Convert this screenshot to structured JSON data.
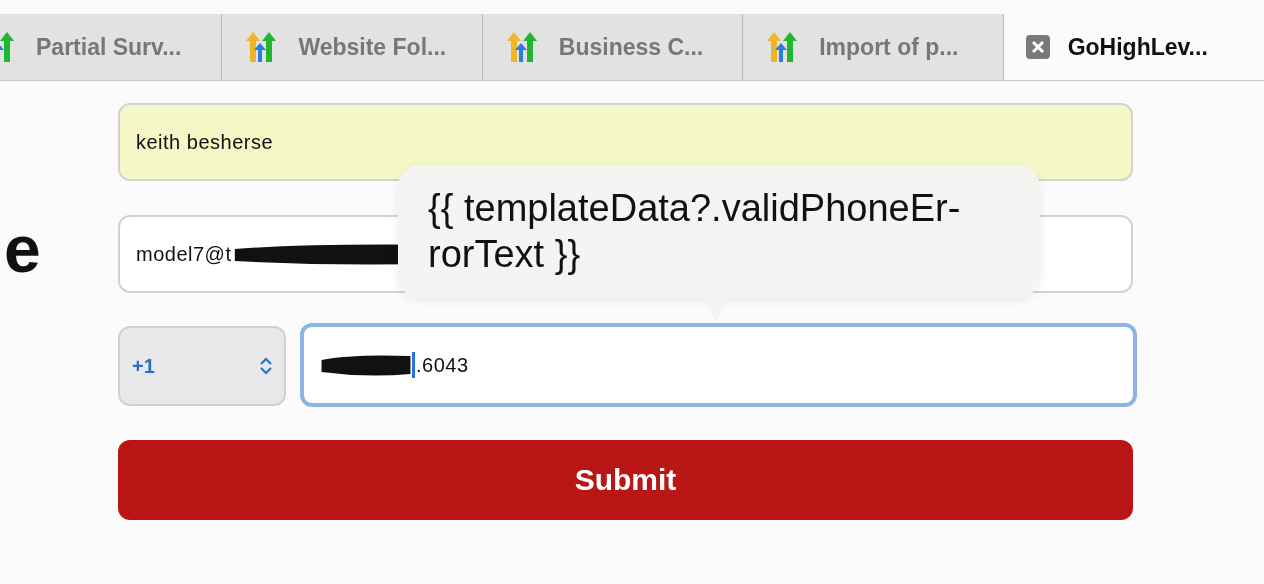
{
  "tabs": [
    {
      "label": "Partial Surv...",
      "selected": false
    },
    {
      "label": "Website Fol...",
      "selected": false
    },
    {
      "label": "Business C...",
      "selected": false
    },
    {
      "label": "Import of p...",
      "selected": false
    },
    {
      "label": "GoHighLev...",
      "selected": true
    }
  ],
  "heading": "e",
  "form": {
    "name_field": {
      "value": "keith besherse",
      "autofilled": true
    },
    "email_field": {
      "value": "model7@t",
      "redacted": true
    },
    "country_select": {
      "value": "+1"
    },
    "phone_field": {
      "value": ".6043",
      "redacted": true,
      "focused": true
    },
    "submit": "Submit"
  },
  "tooltip": {
    "lines": [
      "{{ templateData?.validPhoneEr-",
      "rorText }}"
    ]
  }
}
